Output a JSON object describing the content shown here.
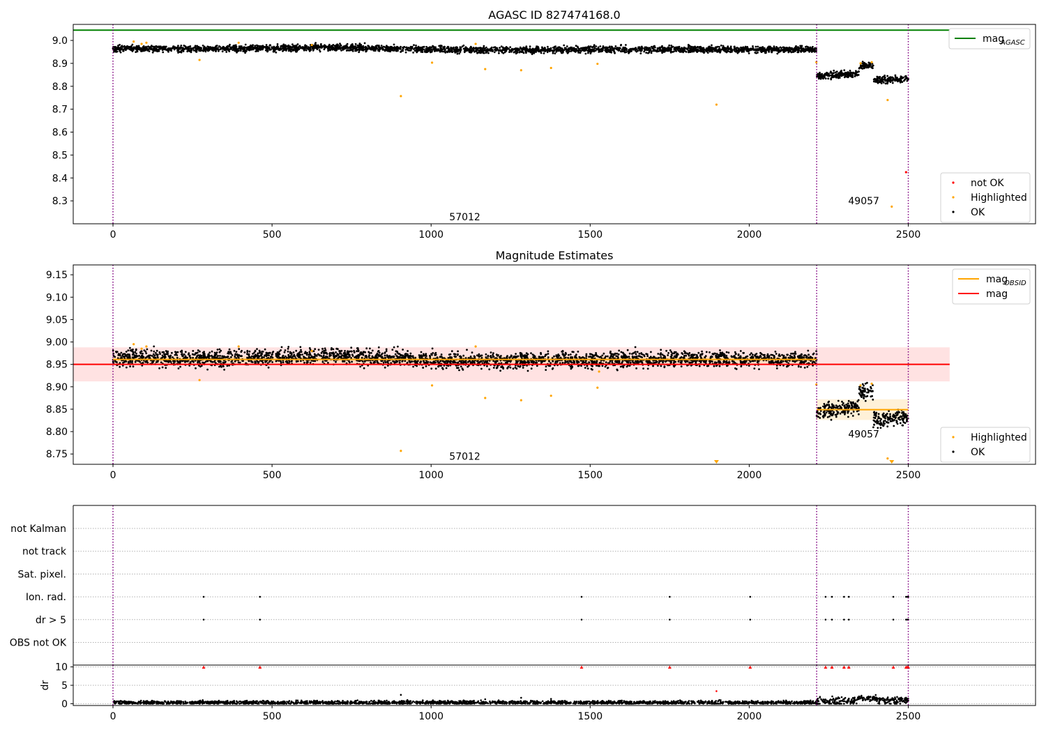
{
  "chart_data": [
    {
      "type": "scatter",
      "title": "AGASC ID 827474168.0",
      "xlabel": "",
      "ylabel": "",
      "xlim": [
        -125,
        2900
      ],
      "ylim": [
        8.2,
        9.07
      ],
      "xticks": [
        0,
        500,
        1000,
        1500,
        2000,
        2500
      ],
      "yticks": [
        8.3,
        8.4,
        8.5,
        8.6,
        8.7,
        8.8,
        8.9,
        9.0
      ],
      "grid": false,
      "obs_boundaries": [
        0,
        2212,
        2500
      ],
      "obs_labels": [
        {
          "text": "57012",
          "x": 1106,
          "y": 8.23
        },
        {
          "text": "49057",
          "x": 2360,
          "y": 8.3
        }
      ],
      "legend_upper": {
        "position": "top-right",
        "entries": [
          {
            "label": "mag",
            "sub": "AGASC",
            "color": "#008000"
          }
        ]
      },
      "legend_lower": {
        "position": "bottom-right",
        "entries": [
          {
            "label": "not OK",
            "color": "#ff0000"
          },
          {
            "label": "Highlighted",
            "color": "#ffa500"
          },
          {
            "label": "OK",
            "color": "#000000"
          }
        ]
      },
      "series": [
        {
          "name": "mag_AGASC",
          "kind": "hline",
          "value": 9.045,
          "x_range": [
            -125,
            2630
          ],
          "color": "#008000"
        },
        {
          "name": "OK",
          "kind": "dense",
          "color": "#000000",
          "segments": [
            {
              "x_range": [
                0,
                2212
              ],
              "profile": [
                [
                  0,
                  8.965
                ],
                [
                  300,
                  8.962
                ],
                [
                  700,
                  8.97
                ],
                [
                  1100,
                  8.958
                ],
                [
                  1500,
                  8.96
                ],
                [
                  1800,
                  8.962
                ],
                [
                  2212,
                  8.96
                ]
              ],
              "jitter": 0.007
            },
            {
              "x_range": [
                2212,
                2345
              ],
              "profile": [
                [
                  2212,
                  8.845
                ],
                [
                  2345,
                  8.855
                ]
              ],
              "jitter": 0.008
            },
            {
              "x_range": [
                2345,
                2390
              ],
              "profile": [
                [
                  2345,
                  8.89
                ],
                [
                  2390,
                  8.89
                ]
              ],
              "jitter": 0.007
            },
            {
              "x_range": [
                2390,
                2500
              ],
              "profile": [
                [
                  2390,
                  8.825
                ],
                [
                  2500,
                  8.835
                ]
              ],
              "jitter": 0.008
            }
          ]
        },
        {
          "name": "Highlighted",
          "kind": "points",
          "color": "#ffa500",
          "x": [
            65,
            90,
            105,
            272,
            395,
            625,
            905,
            1003,
            1140,
            1170,
            1283,
            1377,
            1523,
            1897,
            2211,
            2350,
            2385,
            2435,
            2448
          ],
          "y": [
            8.995,
            8.985,
            8.99,
            8.915,
            8.99,
            8.98,
            8.757,
            8.903,
            8.985,
            8.875,
            8.87,
            8.88,
            8.898,
            8.72,
            8.905,
            8.9,
            8.905,
            8.74,
            8.275
          ]
        },
        {
          "name": "not OK",
          "kind": "points",
          "color": "#ff0000",
          "x": [
            2493
          ],
          "y": [
            8.425
          ]
        }
      ]
    },
    {
      "type": "scatter",
      "title": "Magnitude Estimates",
      "xlabel": "",
      "ylabel": "",
      "xlim": [
        -125,
        2900
      ],
      "ylim": [
        8.727,
        9.172
      ],
      "xticks": [
        0,
        500,
        1000,
        1500,
        2000,
        2500
      ],
      "yticks": [
        8.75,
        8.8,
        8.85,
        8.9,
        8.95,
        9.0,
        9.05,
        9.1,
        9.15
      ],
      "grid": false,
      "obs_boundaries": [
        0,
        2212,
        2500
      ],
      "obs_labels": [
        {
          "text": "57012",
          "x": 1106,
          "y": 8.745
        },
        {
          "text": "49057",
          "x": 2360,
          "y": 8.795
        }
      ],
      "legend_upper": {
        "position": "top-right",
        "entries": [
          {
            "label": "mag",
            "sub": "OBSID",
            "color": "#ffa500"
          },
          {
            "label": "mag",
            "sub": "",
            "color": "#ff0000"
          }
        ]
      },
      "legend_lower": {
        "position": "bottom-right",
        "entries": [
          {
            "label": "Highlighted",
            "color": "#ffa500"
          },
          {
            "label": "OK",
            "color": "#000000"
          }
        ]
      },
      "bands": [
        {
          "name": "mag-band",
          "x_range": [
            -125,
            2630
          ],
          "y_range": [
            8.912,
            8.988
          ],
          "color": "#ffb6b6",
          "opacity": 0.4
        },
        {
          "name": "obs-band-57012",
          "x_range": [
            0,
            2212
          ],
          "y_range": [
            8.953,
            8.968
          ],
          "color": "#ffd27f",
          "opacity": 0.35
        },
        {
          "name": "obs-band-49057",
          "x_range": [
            2212,
            2500
          ],
          "y_range": [
            8.826,
            8.872
          ],
          "color": "#ffd27f",
          "opacity": 0.3
        }
      ],
      "series": [
        {
          "name": "mag",
          "kind": "hline",
          "value": 8.95,
          "x_range": [
            -125,
            2630
          ],
          "color": "#ff0000"
        },
        {
          "name": "mag_OBSID-57012",
          "kind": "hline",
          "value": 8.961,
          "x_range": [
            0,
            2212
          ],
          "color": "#ffa500"
        },
        {
          "name": "mag_OBSID-49057",
          "kind": "hline",
          "value": 8.849,
          "x_range": [
            2212,
            2500
          ],
          "color": "#ffa500"
        },
        {
          "name": "OK",
          "kind": "dense",
          "color": "#000000",
          "segments": [
            {
              "x_range": [
                0,
                2212
              ],
              "profile": [
                [
                  0,
                  8.965
                ],
                [
                  300,
                  8.962
                ],
                [
                  700,
                  8.97
                ],
                [
                  1100,
                  8.958
                ],
                [
                  1500,
                  8.96
                ],
                [
                  1800,
                  8.962
                ],
                [
                  2212,
                  8.96
                ]
              ],
              "jitter": 0.009
            },
            {
              "x_range": [
                2212,
                2345
              ],
              "profile": [
                [
                  2212,
                  8.845
                ],
                [
                  2345,
                  8.855
                ]
              ],
              "jitter": 0.009
            },
            {
              "x_range": [
                2345,
                2390
              ],
              "profile": [
                [
                  2345,
                  8.89
                ],
                [
                  2390,
                  8.89
                ]
              ],
              "jitter": 0.008
            },
            {
              "x_range": [
                2390,
                2500
              ],
              "profile": [
                [
                  2390,
                  8.825
                ],
                [
                  2500,
                  8.835
                ]
              ],
              "jitter": 0.01
            }
          ]
        },
        {
          "name": "Highlighted",
          "kind": "points",
          "color": "#ffa500",
          "x": [
            65,
            90,
            105,
            272,
            395,
            625,
            905,
            1003,
            1140,
            1170,
            1283,
            1377,
            1523,
            1528,
            2211,
            2350,
            2385,
            2435
          ],
          "y": [
            8.995,
            8.985,
            8.99,
            8.915,
            8.99,
            8.98,
            8.757,
            8.903,
            8.99,
            8.875,
            8.87,
            8.88,
            8.898,
            8.934,
            8.905,
            8.903,
            8.907,
            8.74
          ]
        },
        {
          "name": "Highlighted-offscale",
          "kind": "markers",
          "marker": "triangle-down",
          "color": "#ffa500",
          "x": [
            1897,
            2448
          ],
          "y": [
            8.73,
            8.73
          ]
        }
      ]
    },
    {
      "type": "scatter",
      "title": "",
      "xlabel": "",
      "ylabel": "dr",
      "xlim": [
        -125,
        2900
      ],
      "xticks": [
        0,
        500,
        1000,
        1500,
        2000,
        2500
      ],
      "grid": true,
      "obs_boundaries": [
        0,
        2212,
        2500
      ],
      "flag_rows": [
        "not Kalman",
        "not track",
        "Sat. pixel.",
        "Ion. rad.",
        "dr > 5",
        "OBS not OK"
      ],
      "flags": [
        {
          "row": "Ion. rad.",
          "x": [
            285,
            462,
            1473,
            1750,
            2003,
            2240,
            2260,
            2298,
            2313,
            2453,
            2493,
            2497,
            2500
          ]
        },
        {
          "row": "dr > 5",
          "x": [
            285,
            462,
            1473,
            1750,
            2003,
            2240,
            2260,
            2298,
            2313,
            2453,
            2493,
            2497,
            2500
          ]
        }
      ],
      "dr_panel": {
        "ylim": [
          -0.5,
          10.5
        ],
        "yticks": [
          0,
          5,
          10
        ],
        "clip": 10,
        "clipped_x": [
          285,
          462,
          1473,
          1750,
          2003,
          2240,
          2260,
          2298,
          2313,
          2453,
          2493,
          2497,
          2500
        ],
        "outliers": [
          {
            "x": 905,
            "y": 2.4,
            "color": "#000000"
          },
          {
            "x": 1283,
            "y": 1.6,
            "color": "#000000"
          },
          {
            "x": 1897,
            "y": 3.4,
            "color": "#ff0000"
          },
          {
            "x": 1170,
            "y": 1.2,
            "color": "#000000"
          },
          {
            "x": 1377,
            "y": 1.3,
            "color": "#000000"
          }
        ],
        "segments": [
          {
            "x_range": [
              0,
              2212
            ],
            "base": 0.3,
            "jitter": 0.25
          },
          {
            "x_range": [
              2212,
              2340
            ],
            "base": 0.6,
            "jitter": 0.5
          },
          {
            "x_range": [
              2340,
              2400
            ],
            "base": 1.5,
            "jitter": 0.3
          },
          {
            "x_range": [
              2400,
              2500
            ],
            "base": 0.9,
            "jitter": 0.5
          }
        ]
      }
    }
  ]
}
